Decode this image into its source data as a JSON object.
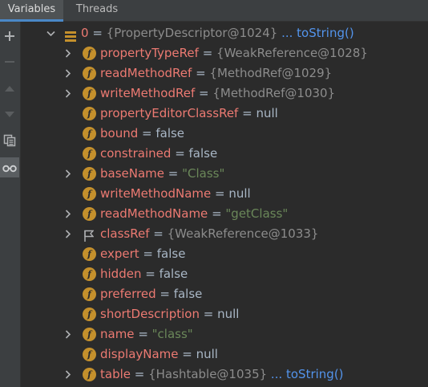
{
  "tabs": [
    {
      "label": "Variables",
      "active": true
    },
    {
      "label": "Threads",
      "active": false
    }
  ],
  "toolbar": [
    {
      "icon": "plus-icon",
      "enabled": true
    },
    {
      "icon": "minus-icon",
      "enabled": false
    },
    {
      "icon": "arrow-up-icon",
      "enabled": false
    },
    {
      "icon": "arrow-down-icon",
      "enabled": false
    },
    {
      "icon": "copy-icon",
      "enabled": true
    },
    {
      "icon": "glasses-icon",
      "enabled": true,
      "selected": true
    }
  ],
  "root": {
    "name": "0",
    "eq": " = ",
    "value": "{PropertyDescriptor@1024}",
    "link": " ... toString()"
  },
  "rows": [
    {
      "name": "propertyTypeRef",
      "eq": " = ",
      "value": "{WeakReference@1028}",
      "kind": "obj",
      "expandable": true,
      "icon": "field-icon"
    },
    {
      "name": "readMethodRef",
      "eq": " = ",
      "value": "{MethodRef@1029}",
      "kind": "obj",
      "expandable": true,
      "icon": "field-icon"
    },
    {
      "name": "writeMethodRef",
      "eq": " = ",
      "value": "{MethodRef@1030}",
      "kind": "obj",
      "expandable": true,
      "icon": "field-icon"
    },
    {
      "name": "propertyEditorClassRef",
      "eq": " = ",
      "value": "null",
      "kind": "val",
      "expandable": false,
      "icon": "field-icon"
    },
    {
      "name": "bound",
      "eq": " = ",
      "value": "false",
      "kind": "val",
      "expandable": false,
      "icon": "field-icon"
    },
    {
      "name": "constrained",
      "eq": " = ",
      "value": "false",
      "kind": "val",
      "expandable": false,
      "icon": "field-icon"
    },
    {
      "name": "baseName",
      "eq": " = ",
      "value": "\"Class\"",
      "kind": "str",
      "expandable": true,
      "icon": "field-icon"
    },
    {
      "name": "writeMethodName",
      "eq": " = ",
      "value": "null",
      "kind": "val",
      "expandable": false,
      "icon": "field-icon"
    },
    {
      "name": "readMethodName",
      "eq": " = ",
      "value": "\"getClass\"",
      "kind": "str",
      "expandable": true,
      "icon": "field-icon"
    },
    {
      "name": "classRef",
      "eq": " = ",
      "value": "{WeakReference@1033}",
      "kind": "obj",
      "expandable": true,
      "icon": "flag-icon"
    },
    {
      "name": "expert",
      "eq": " = ",
      "value": "false",
      "kind": "val",
      "expandable": false,
      "icon": "field-icon"
    },
    {
      "name": "hidden",
      "eq": " = ",
      "value": "false",
      "kind": "val",
      "expandable": false,
      "icon": "field-icon"
    },
    {
      "name": "preferred",
      "eq": " = ",
      "value": "false",
      "kind": "val",
      "expandable": false,
      "icon": "field-icon"
    },
    {
      "name": "shortDescription",
      "eq": " = ",
      "value": "null",
      "kind": "val",
      "expandable": false,
      "icon": "field-icon"
    },
    {
      "name": "name",
      "eq": " = ",
      "value": "\"class\"",
      "kind": "str",
      "expandable": true,
      "icon": "field-icon"
    },
    {
      "name": "displayName",
      "eq": " = ",
      "value": "null",
      "kind": "val",
      "expandable": false,
      "icon": "field-icon"
    },
    {
      "name": "table",
      "eq": " = ",
      "value": "{Hashtable@1035}",
      "kind": "obj",
      "expandable": true,
      "icon": "field-icon",
      "link": " ... toString()"
    }
  ],
  "field_icon_letter": "f"
}
